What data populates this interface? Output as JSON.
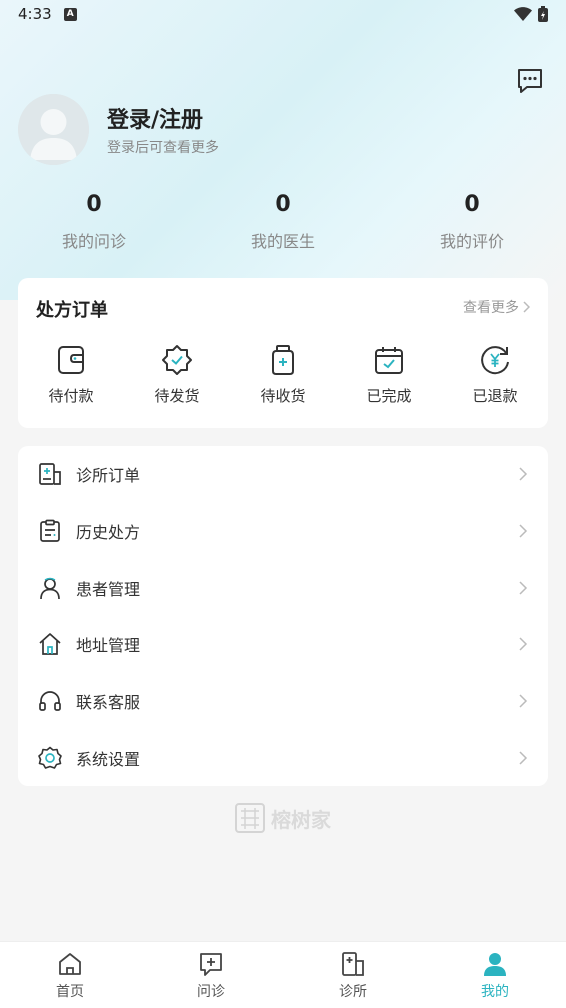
{
  "status_bar": {
    "time": "4:33",
    "indicator": "A"
  },
  "header": {
    "message_icon": "chat-bubble-icon",
    "login_title": "登录/注册",
    "login_subtitle": "登录后可查看更多"
  },
  "stats": [
    {
      "value": "0",
      "label": "我的问诊"
    },
    {
      "value": "0",
      "label": "我的医生"
    },
    {
      "value": "0",
      "label": "我的评价"
    }
  ],
  "orders": {
    "title": "处方订单",
    "more_label": "查看更多",
    "items": [
      {
        "label": "待付款",
        "icon": "wallet-icon"
      },
      {
        "label": "待发货",
        "icon": "badge-check-icon"
      },
      {
        "label": "待收货",
        "icon": "medicine-bottle-icon"
      },
      {
        "label": "已完成",
        "icon": "calendar-check-icon"
      },
      {
        "label": "已退款",
        "icon": "refund-icon"
      }
    ]
  },
  "menu": [
    {
      "label": "诊所订单",
      "icon": "clinic-order-icon"
    },
    {
      "label": "历史处方",
      "icon": "clipboard-icon"
    },
    {
      "label": "患者管理",
      "icon": "user-icon"
    },
    {
      "label": "地址管理",
      "icon": "home-icon"
    },
    {
      "label": "联系客服",
      "icon": "headset-icon"
    },
    {
      "label": "系统设置",
      "icon": "gear-icon"
    }
  ],
  "brand": {
    "name": "榕树家"
  },
  "tabs": [
    {
      "label": "首页",
      "icon": "home-tab-icon",
      "active": false
    },
    {
      "label": "问诊",
      "icon": "consult-icon",
      "active": false
    },
    {
      "label": "诊所",
      "icon": "clinic-icon",
      "active": false
    },
    {
      "label": "我的",
      "icon": "profile-icon",
      "active": true
    }
  ],
  "colors": {
    "accent": "#2bb3c0",
    "icon_stroke": "#333333",
    "background": "#f5f5f5"
  }
}
